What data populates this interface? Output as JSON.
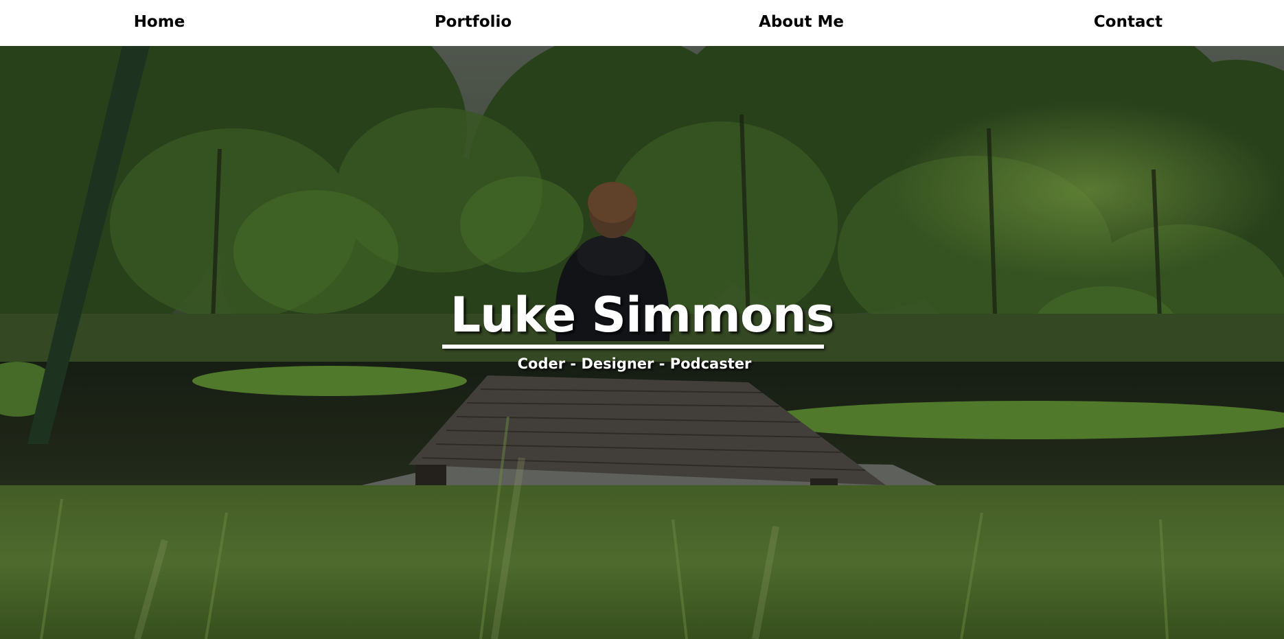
{
  "nav": {
    "items": [
      {
        "label": "Home"
      },
      {
        "label": "Portfolio"
      },
      {
        "label": "About Me"
      },
      {
        "label": "Contact"
      }
    ]
  },
  "hero": {
    "title": "Luke Simmons",
    "subtitle": "Coder - Designer - Podcaster",
    "background": "photo of person in dark hoodie sitting on wooden dock facing pond and green trees"
  },
  "colors": {
    "nav_background": "#ffffff",
    "nav_text": "#000000",
    "hero_text": "#ffffff"
  }
}
